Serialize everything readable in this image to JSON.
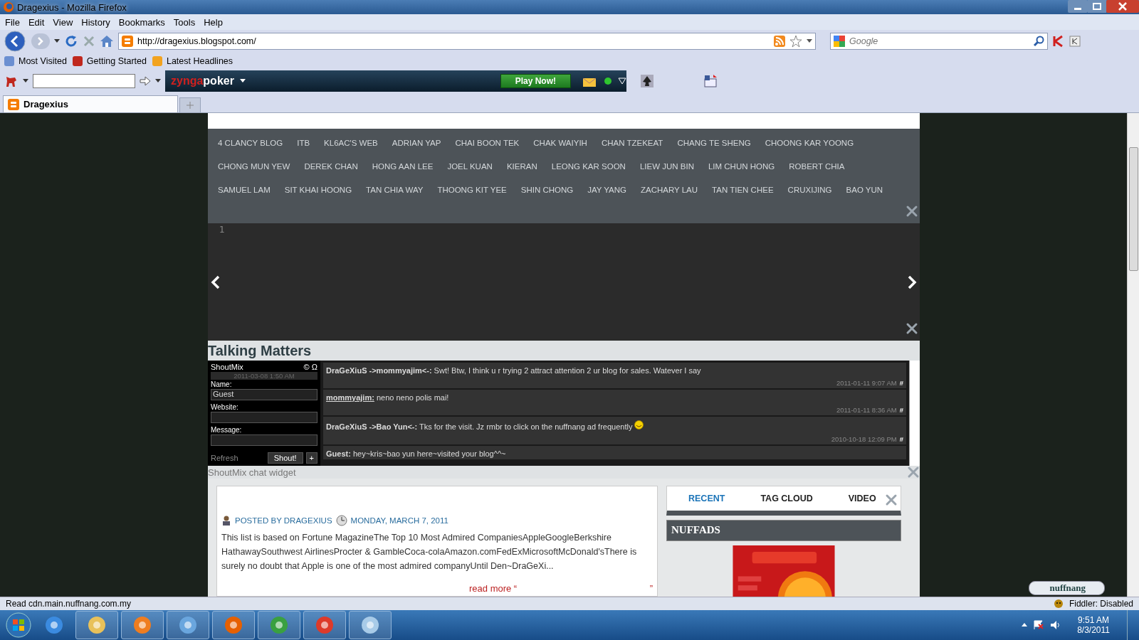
{
  "window": {
    "title": "Dragexius - Mozilla Firefox"
  },
  "menu": [
    "File",
    "Edit",
    "View",
    "History",
    "Bookmarks",
    "Tools",
    "Help"
  ],
  "address": {
    "url": "http://dragexius.blogspot.com/"
  },
  "search": {
    "placeholder": "Google"
  },
  "bookmarks": [
    "Most Visited",
    "Getting Started",
    "Latest Headlines"
  ],
  "zynga_toolbar": {
    "logo_first": "zynga",
    "logo_second": "poker",
    "play_button": "Play Now!"
  },
  "tabs": [
    {
      "label": "Dragexius",
      "selected": true
    }
  ],
  "blog": {
    "nav_links": [
      "4 CLANCY BLOG",
      "ITB",
      "KL6AC'S WEB",
      "ADRIAN YAP",
      "CHAI BOON TEK",
      "CHAK WAIYIH",
      "CHAN TZEKEAT",
      "CHANG TE SHENG",
      "CHOONG KAR YOONG",
      "CHONG MUN YEW",
      "DEREK CHAN",
      "HONG AAN LEE",
      "JOEL KUAN",
      "KIERAN",
      "LEONG KAR SOON",
      "LIEW JUN BIN",
      "LIM CHUN HONG",
      "ROBERT CHIA",
      "SAMUEL LAM",
      "SIT KHAI HOONG",
      "TAN CHIA WAY",
      "THOONG KIT YEE",
      "SHIN CHONG",
      "JAY YANG",
      "ZACHARY LAU",
      "TAN TIEN CHEE",
      "CRUXIJING",
      "BAO YUN"
    ],
    "slider_index": "1",
    "shoutbox_title": "Talking Matters",
    "shoutbox": {
      "brand": "ShoutMix",
      "copyright": "©",
      "omega": "Ω",
      "date": "2011-03-08 1:50 AM",
      "fields": [
        {
          "label": "Name:",
          "value": "Guest"
        },
        {
          "label": "Website:"
        },
        {
          "label": "Message:"
        }
      ],
      "refresh": "Refresh",
      "shout_button": "Shout!",
      "plus_button": "+",
      "messages": [
        {
          "author": "DraGeXiuS ->mommyajim<-:",
          "underlined": false,
          "text": "Swt! Btw, I think u r trying 2 attract attention 2 ur blog for sales. Watever I say",
          "emoticon": false,
          "time": "2011-01-11 9:07 AM",
          "link": "#"
        },
        {
          "author": "mommyajim:",
          "underlined": true,
          "text": "neno neno polis mai!",
          "emoticon": false,
          "time": "2011-01-11 8:36 AM",
          "link": "#"
        },
        {
          "author": "DraGeXiuS ->Bao Yun<-:",
          "underlined": false,
          "text": "Tks for the visit. Jz rmbr to click on the nuffnang ad frequently",
          "emoticon": true,
          "time": "2010-10-18 12:09 PM",
          "link": "#"
        },
        {
          "author": "Guest:",
          "underlined": false,
          "text": "hey~kris~bao yun here~visited your blog^^~",
          "emoticon": false
        }
      ]
    },
    "widget_caption": "ShoutMix chat widget",
    "post": {
      "author": "POSTED BY DRAGEXIUS",
      "date": "MONDAY, MARCH 7, 2011",
      "body": "This list is based on Fortune MagazineThe Top 10 Most Admired CompaniesAppleGoogleBerkshire HathawaySouthwest AirlinesProcter & GambleCoca-colaAmazon.comFedExMicrosoftMcDonald'sThere is surely no doubt that Apple is one of the most admired companyUntil Den~DraGeXi...",
      "read_more": "read more “",
      "end_quote": "”"
    },
    "sidebar": {
      "tabs": [
        {
          "label": "RECENT",
          "selected": true
        },
        {
          "label": "TAG CLOUD",
          "selected": false
        },
        {
          "label": "VIDEO",
          "selected": false
        }
      ],
      "heading": "NUFFADS"
    },
    "badge": "nuffnang"
  },
  "status_bar": {
    "text": "Read cdn.main.nuffnang.com.my",
    "fiddler": "Fiddler: Disabled"
  },
  "taskbar": {
    "time": "9:51 AM",
    "date": "8/3/2011"
  }
}
